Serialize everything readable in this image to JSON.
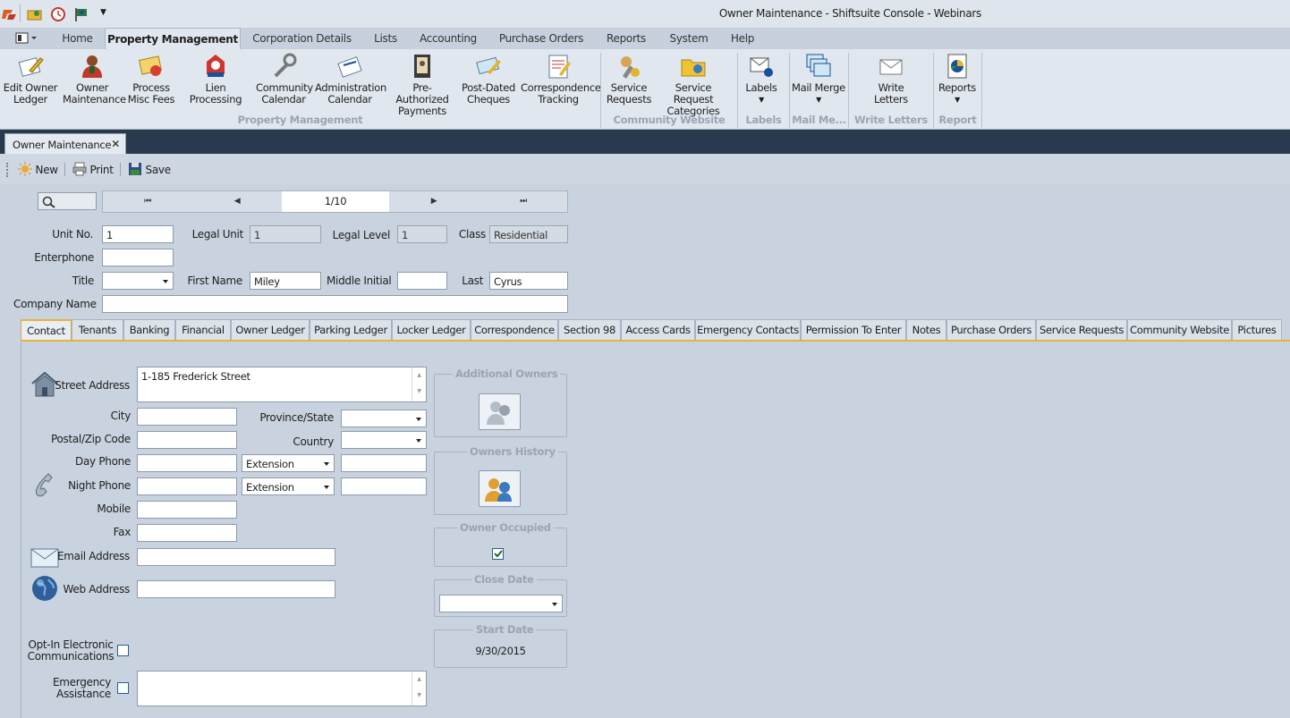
{
  "window": {
    "title": "Owner Maintenance - Shiftsuite Console - Webinars"
  },
  "quick_access": [
    "app-logo-icon",
    "folder-icon",
    "clock-icon",
    "flag-icon",
    "dropdown-arrow-icon"
  ],
  "menu": {
    "view_icon": "layout-icon",
    "items": [
      "Home",
      "Property Management",
      "Corporation Details",
      "Lists",
      "Accounting",
      "Purchase Orders",
      "Reports",
      "System",
      "Help"
    ],
    "active": "Property Management"
  },
  "ribbon": {
    "buttons": [
      {
        "l1": "Edit Owner",
        "l2": "Ledger",
        "icon": "edit-ledger-icon"
      },
      {
        "l1": "Owner",
        "l2": "Maintenance",
        "icon": "owner-icon"
      },
      {
        "l1": "Process",
        "l2": "Misc Fees",
        "icon": "fees-icon"
      },
      {
        "l1": "Lien Processing",
        "l2": "",
        "icon": "lien-icon"
      },
      {
        "l1": "Community",
        "l2": "Calendar",
        "icon": "wrench-icon"
      },
      {
        "l1": "Administration",
        "l2": "Calendar",
        "icon": "admin-calendar-icon"
      },
      {
        "l1": "Pre-Authorized",
        "l2": "Payments",
        "icon": "payments-icon"
      },
      {
        "l1": "Post-Dated",
        "l2": "Cheques",
        "icon": "cheques-icon"
      },
      {
        "l1": "Correspondence",
        "l2": "Tracking",
        "icon": "correspondence-icon"
      },
      {
        "l1": "Service",
        "l2": "Requests",
        "icon": "service-requests-icon"
      },
      {
        "l1": "Service Request",
        "l2": "Categories",
        "icon": "folder-categories-icon"
      },
      {
        "l1": "Labels",
        "l2": "",
        "icon": "labels-icon"
      },
      {
        "l1": "Mail Merge",
        "l2": "",
        "icon": "mail-merge-icon"
      },
      {
        "l1": "Write",
        "l2": "Letters",
        "icon": "letter-icon"
      },
      {
        "l1": "Reports",
        "l2": "",
        "icon": "reports-icon"
      }
    ],
    "groups": [
      "Property Management",
      "Community Website",
      "Labels",
      "Mail Me...",
      "Write Letters",
      "Report"
    ]
  },
  "doc_tab": {
    "label": "Owner Maintenance",
    "close": "✕"
  },
  "toolbar": {
    "new": "New",
    "print": "Print",
    "save": "Save"
  },
  "nav": {
    "record": "1/10",
    "first": "⏮",
    "prev": "◀",
    "next": "▶",
    "last": "⏭"
  },
  "header": {
    "unit_no_label": "Unit No.",
    "unit_no": "1",
    "legal_unit_label": "Legal Unit",
    "legal_unit": "1",
    "legal_level_label": "Legal Level",
    "legal_level": "1",
    "class_label": "Class",
    "class": "Residential",
    "enterphone_label": "Enterphone",
    "enterphone": "",
    "title_label": "Title",
    "title": "",
    "first_name_label": "First Name",
    "first_name": "Miley",
    "middle_initial_label": "Middle Initial",
    "middle_initial": "",
    "last_label": "Last",
    "last": "Cyrus",
    "company_label": "Company Name",
    "company": ""
  },
  "tabs": [
    "Contact",
    "Tenants",
    "Banking",
    "Financial",
    "Owner Ledger",
    "Parking Ledger",
    "Locker Ledger",
    "Correspondence",
    "Section 98",
    "Access Cards",
    "Emergency Contacts",
    "Permission To Enter",
    "Notes",
    "Purchase Orders",
    "Service Requests",
    "Community Website",
    "Pictures"
  ],
  "active_tab": "Contact",
  "contact": {
    "street_label": "Street Address",
    "street": "1-185 Frederick Street",
    "city_label": "City",
    "city": "",
    "province_label": "Province/State",
    "province": "",
    "postal_label": "Postal/Zip Code",
    "postal": "",
    "country_label": "Country",
    "country": "",
    "day_phone_label": "Day Phone",
    "day_phone": "",
    "day_ext": "Extension",
    "day_ext_value": "",
    "night_phone_label": "Night Phone",
    "night_phone": "",
    "night_ext": "Extension",
    "night_ext_value": "",
    "mobile_label": "Mobile",
    "mobile": "",
    "fax_label": "Fax",
    "fax": "",
    "email_label": "Email Address",
    "email": "",
    "web_label": "Web Address",
    "web": "",
    "optin_label_1": "Opt-In Electronic",
    "optin_label_2": "Communications",
    "optin_checked": false,
    "emergency_label_1": "Emergency",
    "emergency_label_2": "Assistance",
    "emergency_checked": false,
    "emergency_notes": ""
  },
  "side": {
    "additional_owners": "Additional Owners",
    "owners_history": "Owners History",
    "owner_occupied": "Owner Occupied",
    "owner_occupied_checked": true,
    "close_date": "Close Date",
    "close_date_value": "",
    "start_date": "Start Date",
    "start_date_value": "9/30/2015"
  },
  "colors": {
    "accent": "#e8b33b",
    "tabstrip": "#2a3a4e",
    "panel": "#c9d3df",
    "ribbon": "#e1e7ee"
  }
}
